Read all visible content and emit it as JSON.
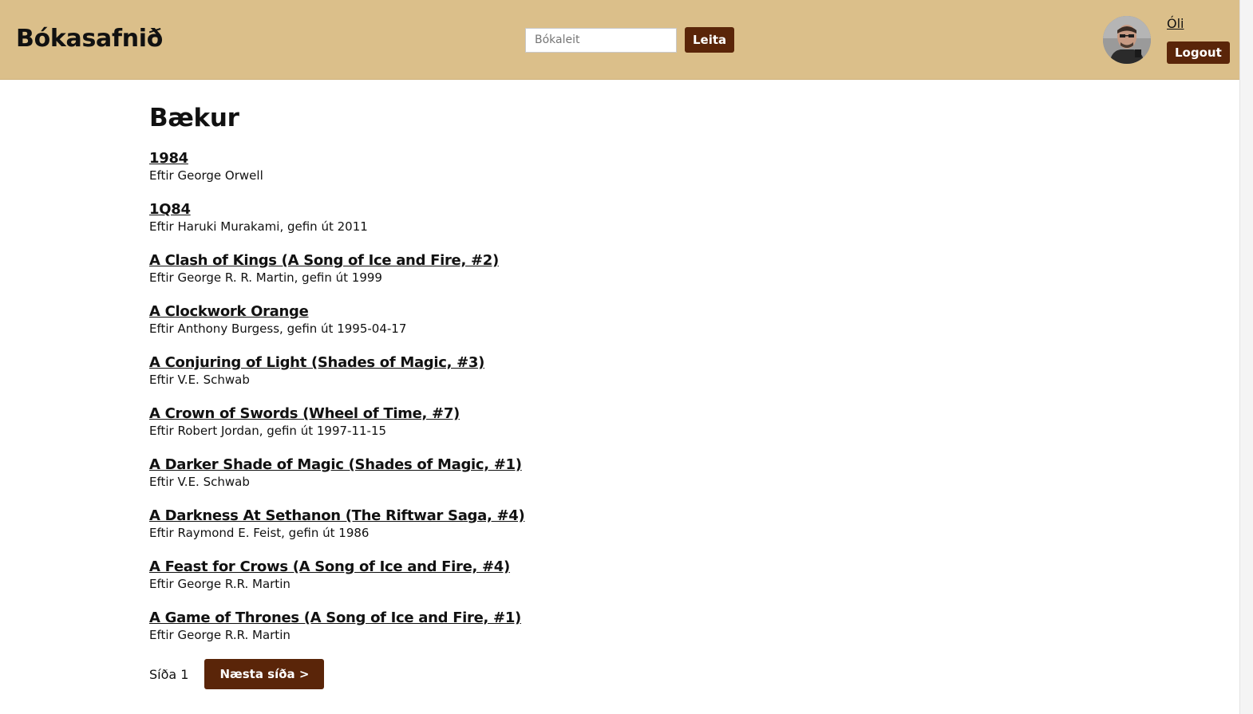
{
  "header": {
    "logo": "Bókasafnið",
    "search": {
      "placeholder": "Bókaleit",
      "value": "",
      "button_label": "Leita"
    },
    "user": {
      "name": "Óli",
      "logout_label": "Logout"
    }
  },
  "main": {
    "title": "Bækur",
    "books": [
      {
        "title": "1984",
        "meta": "Eftir George Orwell"
      },
      {
        "title": "1Q84",
        "meta": "Eftir Haruki Murakami, gefin út 2011"
      },
      {
        "title": "A Clash of Kings (A Song of Ice and Fire, #2)",
        "meta": "Eftir George R. R. Martin, gefin út 1999"
      },
      {
        "title": "A Clockwork Orange",
        "meta": "Eftir Anthony Burgess, gefin út 1995-04-17"
      },
      {
        "title": "A Conjuring of Light (Shades of Magic, #3)",
        "meta": "Eftir V.E. Schwab"
      },
      {
        "title": "A Crown of Swords (Wheel of Time, #7)",
        "meta": "Eftir Robert Jordan, gefin út 1997-11-15"
      },
      {
        "title": "A Darker Shade of Magic (Shades of Magic, #1)",
        "meta": "Eftir V.E. Schwab"
      },
      {
        "title": "A Darkness At Sethanon (The Riftwar Saga, #4)",
        "meta": "Eftir Raymond E. Feist, gefin út 1986"
      },
      {
        "title": "A Feast for Crows (A Song of Ice and Fire, #4)",
        "meta": "Eftir George R.R. Martin"
      },
      {
        "title": "A Game of Thrones (A Song of Ice and Fire, #1)",
        "meta": "Eftir George R.R. Martin"
      }
    ],
    "pagination": {
      "current_label": "Síða 1",
      "next_label": "Næsta síða >"
    }
  },
  "colors": {
    "header_bg": "#dbbf8a",
    "button_bg": "#5a2509",
    "button_text": "#ffffff"
  },
  "icons": {
    "avatar": "user-avatar-photo"
  }
}
